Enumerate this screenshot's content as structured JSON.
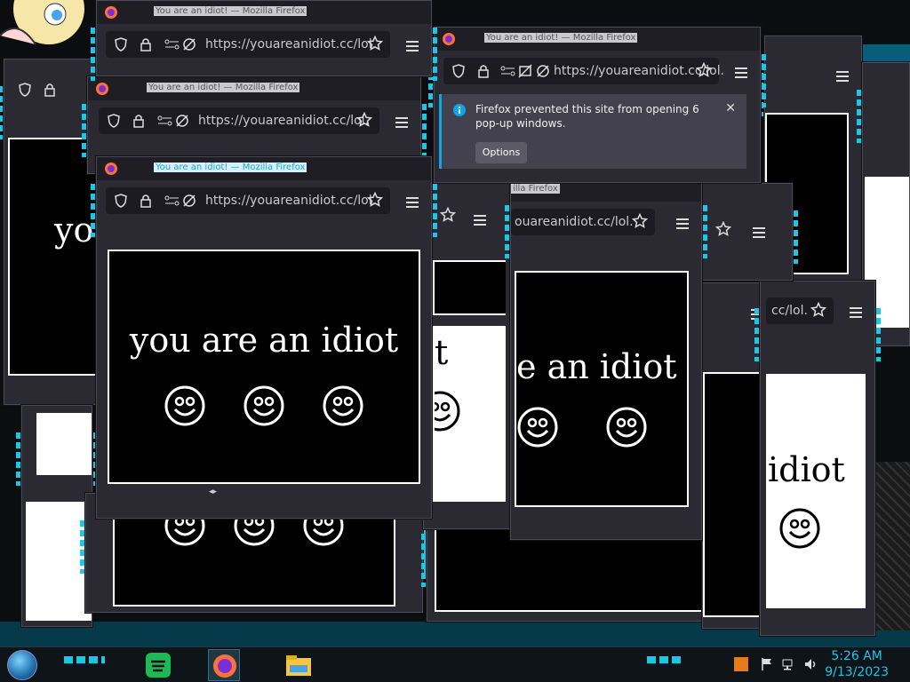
{
  "window": {
    "title": "You are an idiot! — Mozilla Firefox",
    "url": "https://youareanidiot.cc/lol.",
    "heading": "you are an idiot"
  },
  "notification": {
    "message": "Firefox prevented this site from opening 6 pop-up windows.",
    "options_label": "Options",
    "close_glyph": "✕"
  },
  "partial": {
    "title_fragment": "illa Firefox",
    "url_fragment": "ouareanidiot.cc/lol.",
    "url_fragment_short": "cc/lol.",
    "heading_fragment_a": "e an idiot",
    "heading_fragment_b": "iot",
    "heading_fragment_c": "idiot",
    "heading_fragment_d": "yo",
    "heading_fragment_e": "t"
  },
  "resize_handle": "◂▸",
  "taskbar": {
    "apps": [
      "start-orb",
      "spotify",
      "firefox",
      "file-explorer"
    ],
    "tray_icons": [
      "flag-icon",
      "network-icon",
      "volume-icon"
    ],
    "time": "5:26 AM",
    "date": "9/13/2023"
  },
  "colors": {
    "accent": "#18c8e8",
    "window_bg": "#2b2a33",
    "notification_bg": "#42414d",
    "info_blue": "#0ea5e9"
  }
}
